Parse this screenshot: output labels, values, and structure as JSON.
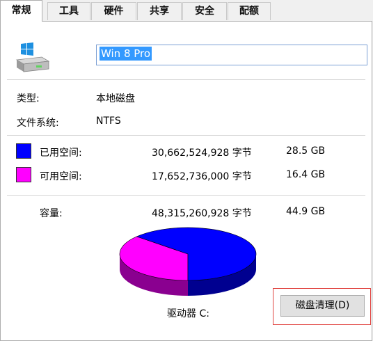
{
  "tabs": [
    {
      "label": "常规",
      "active": true
    },
    {
      "label": "工具"
    },
    {
      "label": "硬件"
    },
    {
      "label": "共享"
    },
    {
      "label": "安全"
    },
    {
      "label": "配额"
    }
  ],
  "drive": {
    "icon": "hard-drive-windows-icon",
    "name": "Win 8 Pro"
  },
  "properties": {
    "type_label": "类型:",
    "type_value": "本地磁盘",
    "fs_label": "文件系统:",
    "fs_value": "NTFS"
  },
  "usage": {
    "used_label": "已用空间:",
    "used_bytes": "30,662,524,928 字节",
    "used_size": "28.5 GB",
    "used_color": "#0000ff",
    "free_label": "可用空间:",
    "free_bytes": "17,652,736,000 字节",
    "free_size": "16.4 GB",
    "free_color": "#ff00ff",
    "capacity_label": "容量:",
    "capacity_bytes": "48,315,260,928 字节",
    "capacity_size": "44.9 GB",
    "used_fraction": 0.635
  },
  "drive_label": "驱动器 C:",
  "cleanup_button": "磁盘清理(D)"
}
